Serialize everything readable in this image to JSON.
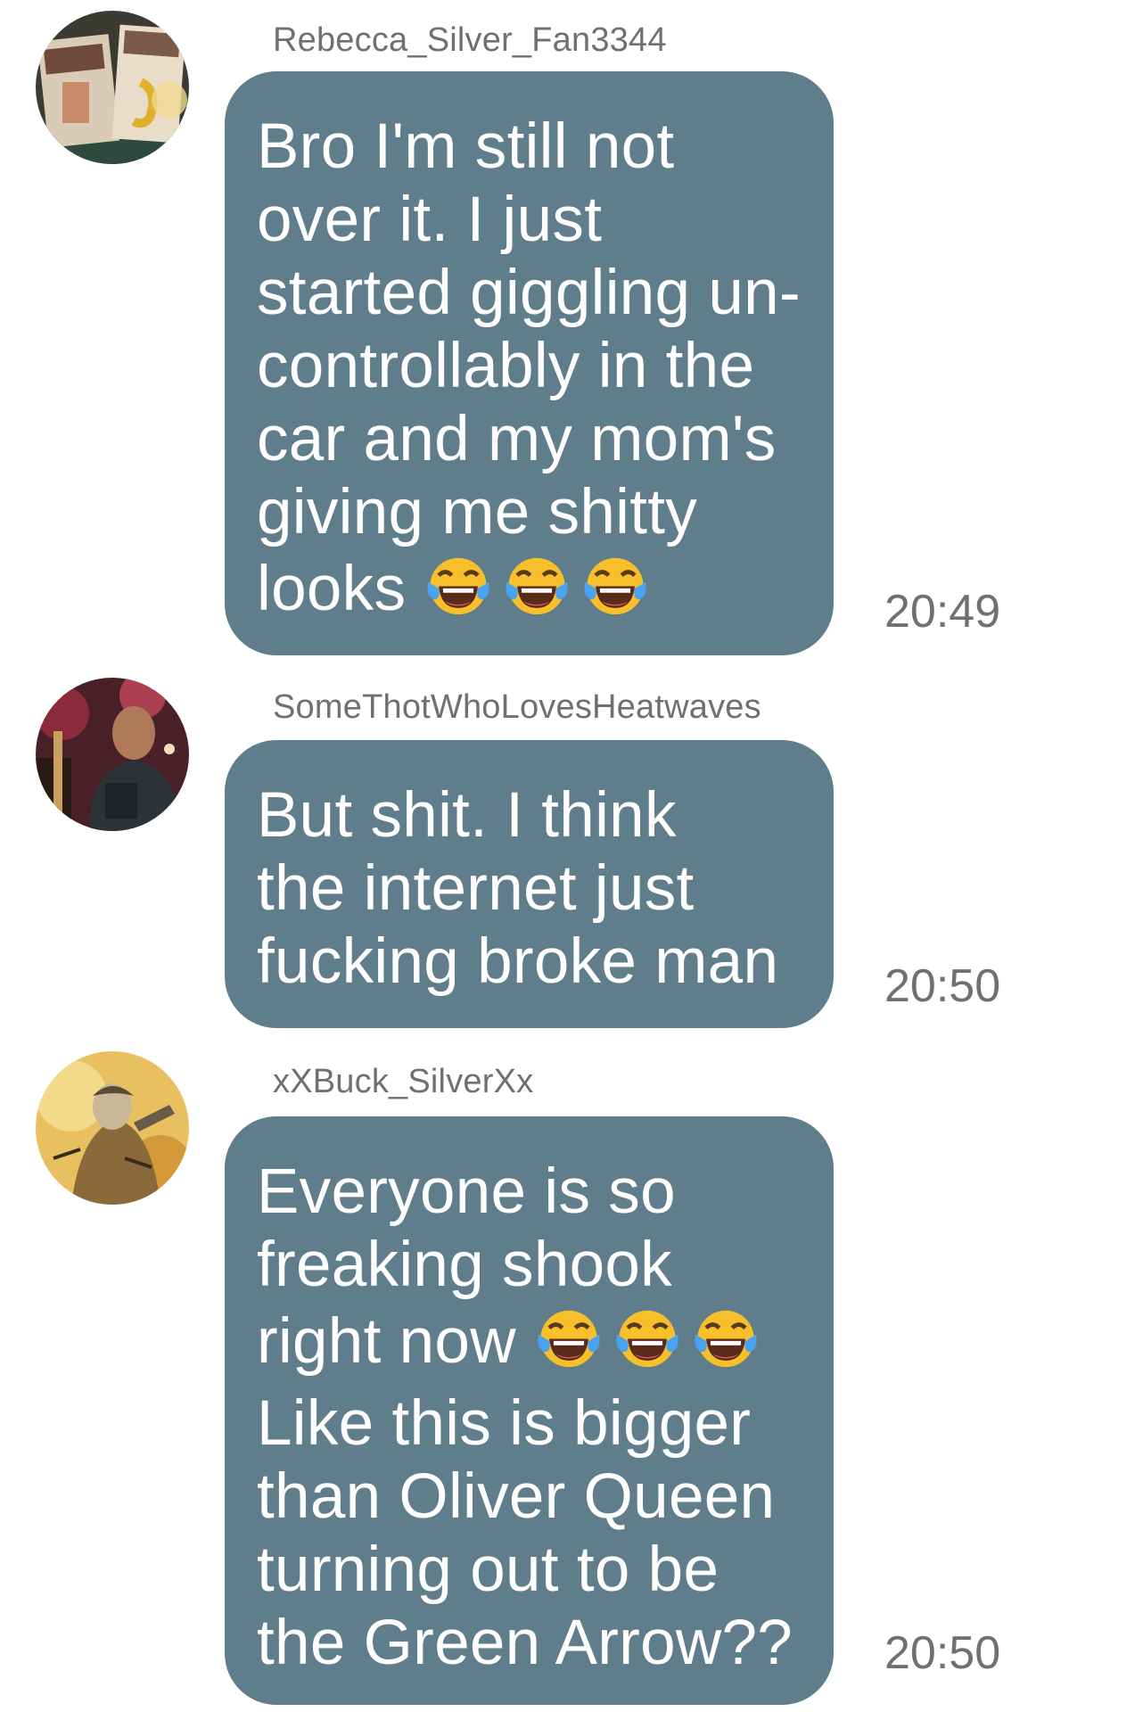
{
  "messages": [
    {
      "username": "Rebecca_Silver_Fan3344",
      "text": "Bro I'm still not\nover it. I just\nstarted giggling un-\ncontrollably in the\ncar and my mom's\ngiving me shitty\nlooks ",
      "emojis": [
        "tears-of-joy-emoji",
        "tears-of-joy-emoji",
        "tears-of-joy-emoji"
      ],
      "time": "20:49",
      "avatar": "uncaged-desire-book-photo"
    },
    {
      "username": "SomeThotWhoLovesHeatwaves",
      "text": "But shit. I think\nthe internet just\nfucking broke man",
      "time": "20:50",
      "avatar": "man-in-jacket-photo"
    },
    {
      "username": "xXBuck_SilverXx",
      "text_before": "Everyone is so\nfreaking shook\nright now ",
      "emojis": [
        "tears-of-joy-emoji",
        "tears-of-joy-emoji",
        "tears-of-joy-emoji"
      ],
      "text_after": "\nLike this is bigger\nthan Oliver Queen\nturning out to be\nthe Green Arrow??",
      "time": "20:50",
      "avatar": "comic-character-illustration"
    }
  ],
  "colors": {
    "bubble": "#5f7d8b",
    "bubble_text": "#ffffff",
    "meta_text": "#707070",
    "background": "#ffffff"
  }
}
